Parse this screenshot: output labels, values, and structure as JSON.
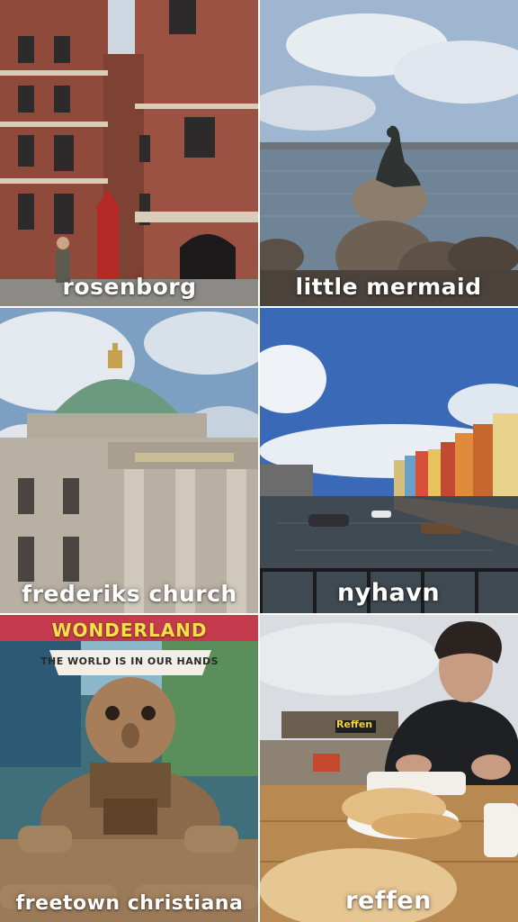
{
  "tiles": [
    {
      "caption": "rosenborg"
    },
    {
      "caption": "little mermaid"
    },
    {
      "caption": "frederiks church"
    },
    {
      "caption": "nyhavn"
    },
    {
      "caption": "freetown christiana",
      "sign_top": "WONDERLAND",
      "sign_banner": "THE WORLD IS IN OUR HANDS"
    },
    {
      "caption": "reffen",
      "sign": "Reffen"
    }
  ],
  "colors": {
    "caption_text": "#ffffff",
    "brick": "#9a4a3a",
    "sky": "#7fa3c9",
    "water": "#6f8597",
    "copper_dome": "#6f9c83",
    "stone": "#b8b0a2",
    "wonderland_sign": "#e8536b"
  },
  "icons": [
    "castle-photo",
    "mermaid-statue-photo",
    "church-photo",
    "canal-photo",
    "troll-sculpture-photo",
    "food-photo"
  ]
}
